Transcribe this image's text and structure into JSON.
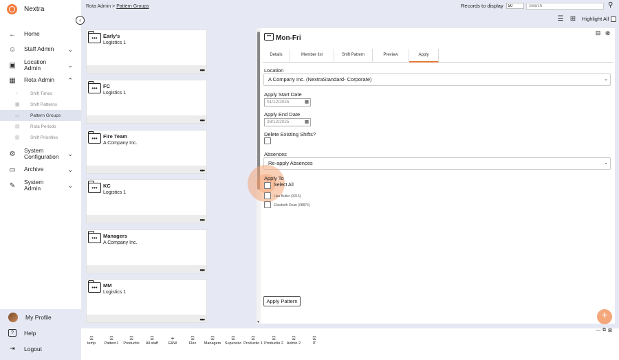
{
  "brand": {
    "name": "Nextra"
  },
  "sidebar": {
    "collapse_glyph": "‹",
    "items": [
      {
        "label": "Home",
        "icon": "←"
      },
      {
        "label": "Staff Admin",
        "icon": "☺",
        "chevron": "⌄"
      },
      {
        "label": "Location Admin",
        "icon": "▣",
        "chevron": "⌄"
      },
      {
        "label": "Rota Admin",
        "icon": "▦",
        "chevron": "⌃"
      },
      {
        "label": "System Configuration",
        "icon": "⚙",
        "chevron": "⌄"
      },
      {
        "label": "Archive",
        "icon": "▭",
        "chevron": "⌄"
      },
      {
        "label": "System Admin",
        "icon": "✎",
        "chevron": "⌄"
      }
    ],
    "subitems": [
      {
        "label": "Shift Times"
      },
      {
        "label": "Shift Patterns"
      },
      {
        "label": "Pattern Groups"
      },
      {
        "label": "Rota Periods"
      },
      {
        "label": "Shift Priorities"
      }
    ],
    "footer": [
      {
        "label": "My Profile"
      },
      {
        "label": "Help",
        "icon": "?"
      },
      {
        "label": "Logout",
        "icon": "⇥"
      }
    ]
  },
  "breadcrumb": {
    "root": "Rota Admin",
    "sep": ">",
    "current": "Pattern Groups"
  },
  "records": {
    "label": "Records to display",
    "value": "50"
  },
  "search": {
    "placeholder": "Search"
  },
  "highlight": {
    "label": "Highlight All"
  },
  "cards": [
    {
      "title": "Early's",
      "sub": "Logistics 1"
    },
    {
      "title": "FC",
      "sub": "Logistics 1"
    },
    {
      "title": "Fire Team",
      "sub": "A Company Inc."
    },
    {
      "title": "KC",
      "sub": "Logistics 1"
    },
    {
      "title": "Managers",
      "sub": "A Company Inc."
    },
    {
      "title": "MM",
      "sub": "Logistics 1"
    }
  ],
  "card_menu": "•••",
  "panel": {
    "title": "Mon-Fri",
    "tabs": [
      "Details",
      "Member list",
      "Shift Pattern",
      "Preview",
      "Apply"
    ],
    "location": {
      "label": "Location",
      "value": "A Company Inc. (NextraStandard- Corporate)"
    },
    "start": {
      "label": "Apply Start Date",
      "value": "01/12/2025"
    },
    "end": {
      "label": "Apply End Date",
      "value": "28/12/2025"
    },
    "delete_label": "Delete Existing Shifts?",
    "absences": {
      "label": "Absences",
      "value": "Re-apply Absences"
    },
    "apply_to": {
      "label": "Apply To",
      "select_all": "Select All"
    },
    "members": [
      "Lisa Butler (3215)",
      "Elizabeth Dean (08876)"
    ],
    "apply_button": "Apply Pattern"
  },
  "fab": "+",
  "groups": [
    {
      "label": "temp"
    },
    {
      "label": "Pattern1"
    },
    {
      "label": "Productio"
    },
    {
      "label": "All staff"
    },
    {
      "label": "E&W",
      "icon": "location-pin-icon"
    },
    {
      "label": "Flex"
    },
    {
      "label": "Managers"
    },
    {
      "label": "Supervisc"
    },
    {
      "label": "Productio 1"
    },
    {
      "label": "Productio 2"
    },
    {
      "label": "Admin 2"
    },
    {
      "label": "IT"
    }
  ],
  "colors": {
    "accent": "#f07a3c",
    "sidebar_active": "#dfe3f0",
    "background": "#e6e9f4"
  }
}
